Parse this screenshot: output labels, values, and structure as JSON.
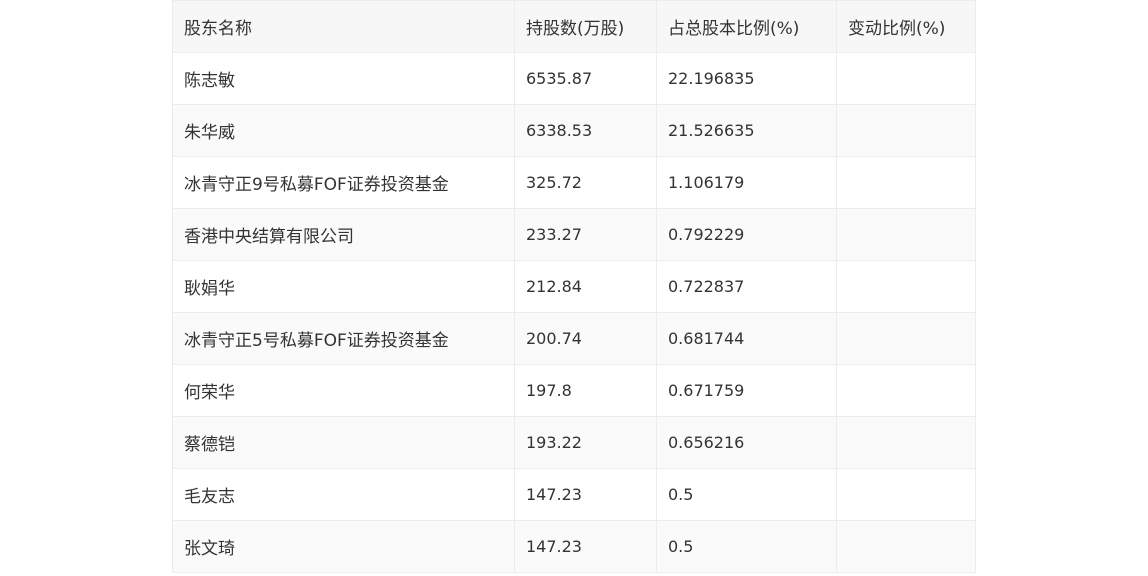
{
  "table": {
    "headers": [
      "股东名称",
      "持股数(万股)",
      "占总股本比例(%)",
      "变动比例(%)"
    ],
    "rows": [
      {
        "name": "陈志敏",
        "shares": "6535.87",
        "ratio": "22.196835",
        "change": ""
      },
      {
        "name": "朱华威",
        "shares": "6338.53",
        "ratio": "21.526635",
        "change": ""
      },
      {
        "name": "冰青守正9号私募FOF证券投资基金",
        "shares": "325.72",
        "ratio": "1.106179",
        "change": ""
      },
      {
        "name": "香港中央结算有限公司",
        "shares": "233.27",
        "ratio": "0.792229",
        "change": ""
      },
      {
        "name": "耿娟华",
        "shares": "212.84",
        "ratio": "0.722837",
        "change": ""
      },
      {
        "name": "冰青守正5号私募FOF证券投资基金",
        "shares": "200.74",
        "ratio": "0.681744",
        "change": ""
      },
      {
        "name": "何荣华",
        "shares": "197.8",
        "ratio": "0.671759",
        "change": ""
      },
      {
        "name": "蔡德铠",
        "shares": "193.22",
        "ratio": "0.656216",
        "change": ""
      },
      {
        "name": "毛友志",
        "shares": "147.23",
        "ratio": "0.5",
        "change": ""
      },
      {
        "name": "张文琦",
        "shares": "147.23",
        "ratio": "0.5",
        "change": ""
      }
    ]
  }
}
